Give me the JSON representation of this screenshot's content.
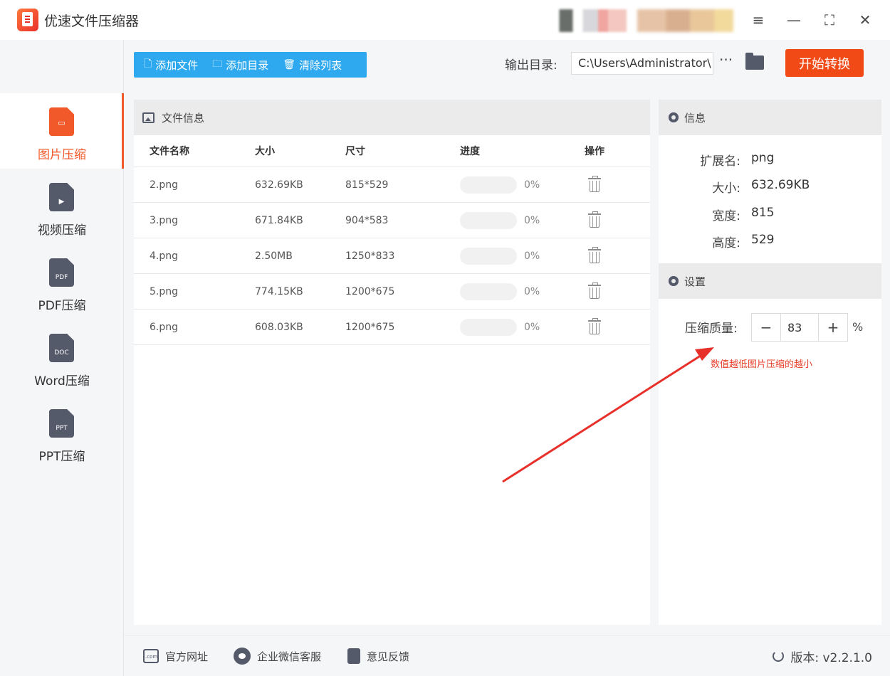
{
  "app": {
    "title": "优速文件压缩器"
  },
  "window_controls": {
    "menu": "≡",
    "minimize": "—",
    "maximize": "⛶",
    "close": "✕"
  },
  "sidebar": {
    "items": [
      {
        "label": "图片压缩",
        "icon": "image-file-icon",
        "tag": "",
        "active": true
      },
      {
        "label": "视频压缩",
        "icon": "video-file-icon",
        "tag": "▶",
        "active": false
      },
      {
        "label": "PDF压缩",
        "icon": "pdf-file-icon",
        "tag": "PDF",
        "active": false
      },
      {
        "label": "Word压缩",
        "icon": "doc-file-icon",
        "tag": "DOC",
        "active": false
      },
      {
        "label": "PPT压缩",
        "icon": "ppt-file-icon",
        "tag": "PPT",
        "active": false
      }
    ]
  },
  "toolbar": {
    "add_file": "添加文件",
    "add_dir": "添加目录",
    "clear_list": "清除列表",
    "output_label": "输出目录:",
    "output_path": "C:\\Users\\Administrator\\",
    "more": "···",
    "start": "开始转换"
  },
  "file_panel": {
    "title": "文件信息",
    "columns": [
      "文件名称",
      "大小",
      "尺寸",
      "进度",
      "操作"
    ],
    "rows": [
      {
        "name": "2.png",
        "size": "632.69KB",
        "dims": "815*529",
        "progress": "0%"
      },
      {
        "name": "3.png",
        "size": "671.84KB",
        "dims": "904*583",
        "progress": "0%"
      },
      {
        "name": "4.png",
        "size": "2.50MB",
        "dims": "1250*833",
        "progress": "0%"
      },
      {
        "name": "5.png",
        "size": "774.15KB",
        "dims": "1200*675",
        "progress": "0%"
      },
      {
        "name": "6.png",
        "size": "608.03KB",
        "dims": "1200*675",
        "progress": "0%"
      }
    ]
  },
  "info_panel": {
    "title": "信息",
    "fields": [
      {
        "key": "扩展名:",
        "value": "png"
      },
      {
        "key": "大小:",
        "value": "632.69KB"
      },
      {
        "key": "宽度:",
        "value": "815"
      },
      {
        "key": "高度:",
        "value": "529"
      }
    ],
    "settings_title": "设置",
    "quality_label": "压缩质量:",
    "quality_value": "83",
    "minus": "−",
    "plus": "+",
    "percent": "%",
    "hint": "数值越低图片压缩的越小"
  },
  "footer": {
    "website": "官方网址",
    "wechat": "企业微信客服",
    "feedback": "意见反馈",
    "version": "版本: v2.2.1.0"
  },
  "colors": {
    "accent": "#f24a17",
    "toolbar": "#2ea8ee",
    "hint": "#e8402a",
    "arrow": "#e8302a"
  }
}
